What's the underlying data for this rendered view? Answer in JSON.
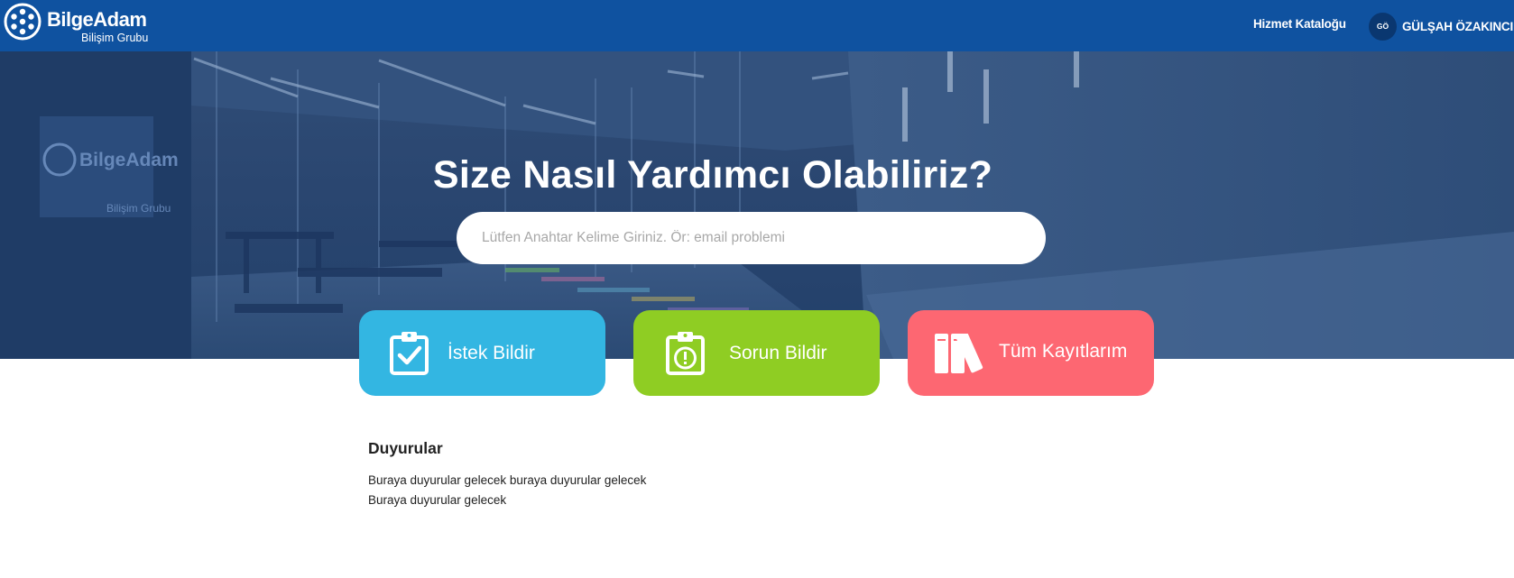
{
  "header": {
    "logo_name": "BilgeAdam",
    "logo_subtitle": "Bilişim Grubu",
    "nav_catalog": "Hizmet Kataloğu",
    "user_initials": "GÖ",
    "user_name": "GÜLŞAH ÖZAKINCI",
    "background_color": "#0f52a0"
  },
  "hero": {
    "title": "Size Nasıl Yardımcı Olabiliriz?",
    "search_placeholder": "Lütfen Anahtar Kelime Giriniz. Ör: email problemi",
    "wall_sign_name": "BilgeAdam",
    "wall_sign_sub": "Bilişim Grubu"
  },
  "actions": [
    {
      "label": "İstek Bildir",
      "icon": "clipboard-check-icon",
      "color": "#33b6e2"
    },
    {
      "label": "Sorun Bildir",
      "icon": "clipboard-alert-icon",
      "color": "#8fcd23"
    },
    {
      "label": "Tüm Kayıtlarım",
      "icon": "books-icon",
      "color": "#fd6772"
    }
  ],
  "announcements": {
    "title": "Duyurular",
    "lines": [
      "Buraya duyurular gelecek buraya duyurular gelecek",
      "Buraya duyurular gelecek"
    ]
  }
}
